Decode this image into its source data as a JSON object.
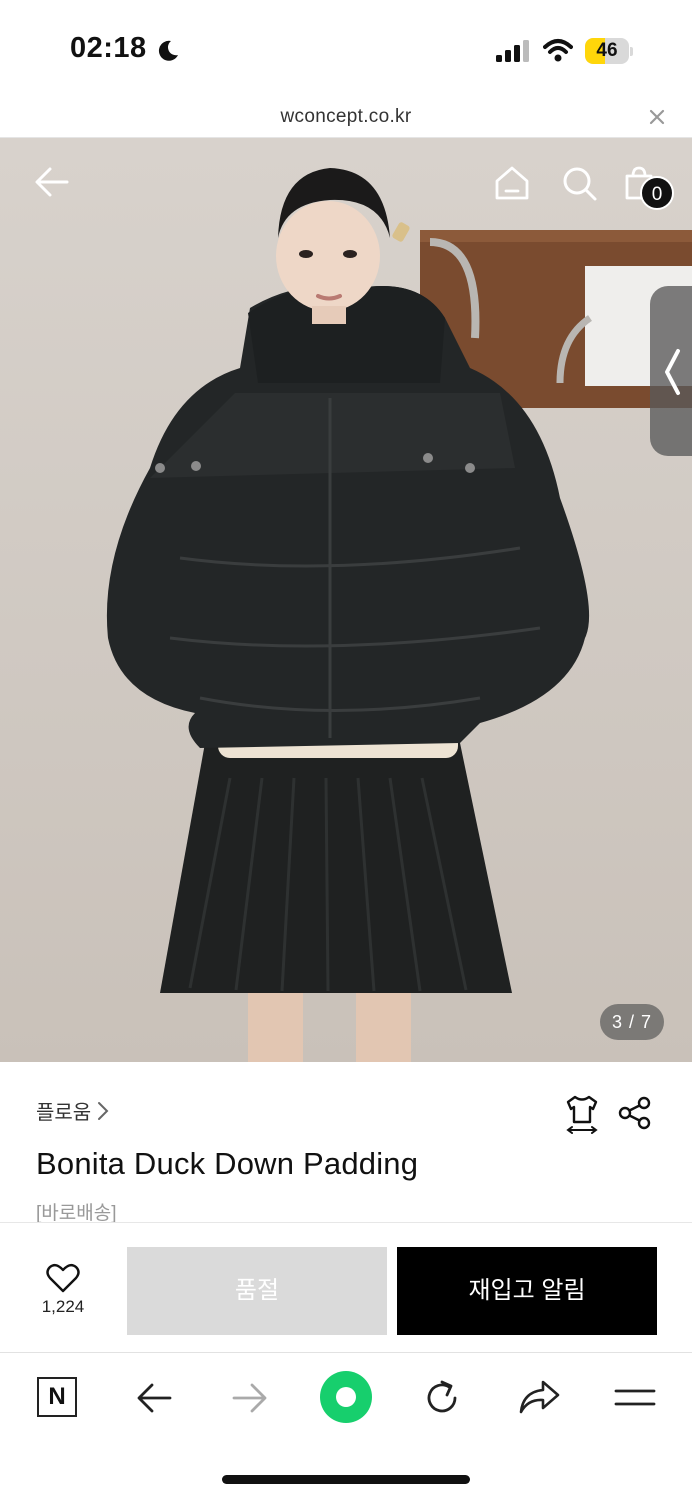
{
  "status_bar": {
    "time": "02:18",
    "battery_level": "46",
    "battery_fraction": 0.46,
    "icons": [
      "moon-icon",
      "signal-icon",
      "wifi-icon",
      "battery-icon"
    ]
  },
  "url_bar": {
    "url": "wconcept.co.kr",
    "close_icon": "close-icon"
  },
  "hero": {
    "nav_icons": [
      "back-arrow-icon",
      "home-icon",
      "search-icon",
      "shopping-bag-icon"
    ],
    "bag_count": "0",
    "image_counter": "3 / 7",
    "side_tab_icon": "chevron-left-icon"
  },
  "product": {
    "brand": "플로움",
    "brand_chevron_icon": "chevron-right-icon",
    "name": "Bonita Duck Down Padding",
    "delivery_tag": "[바로배송]",
    "size_icon": "size-guide-icon",
    "share_icon": "share-icon"
  },
  "purchase_bar": {
    "wishlist_icon": "heart-icon",
    "wishlist_count": "1,224",
    "soldout_label": "품절",
    "restock_label": "재입고 알림"
  },
  "toolbar": {
    "items": [
      "naver-logo-icon",
      "back-icon",
      "forward-icon",
      "green-dot-icon",
      "reload-icon",
      "share-icon",
      "menu-icon"
    ],
    "naver_letter": "N"
  },
  "colors": {
    "accent_green": "#17cf6d",
    "battery_yellow": "#ffd60a",
    "soldout_gray": "#dadada",
    "primary_black": "#000000"
  }
}
